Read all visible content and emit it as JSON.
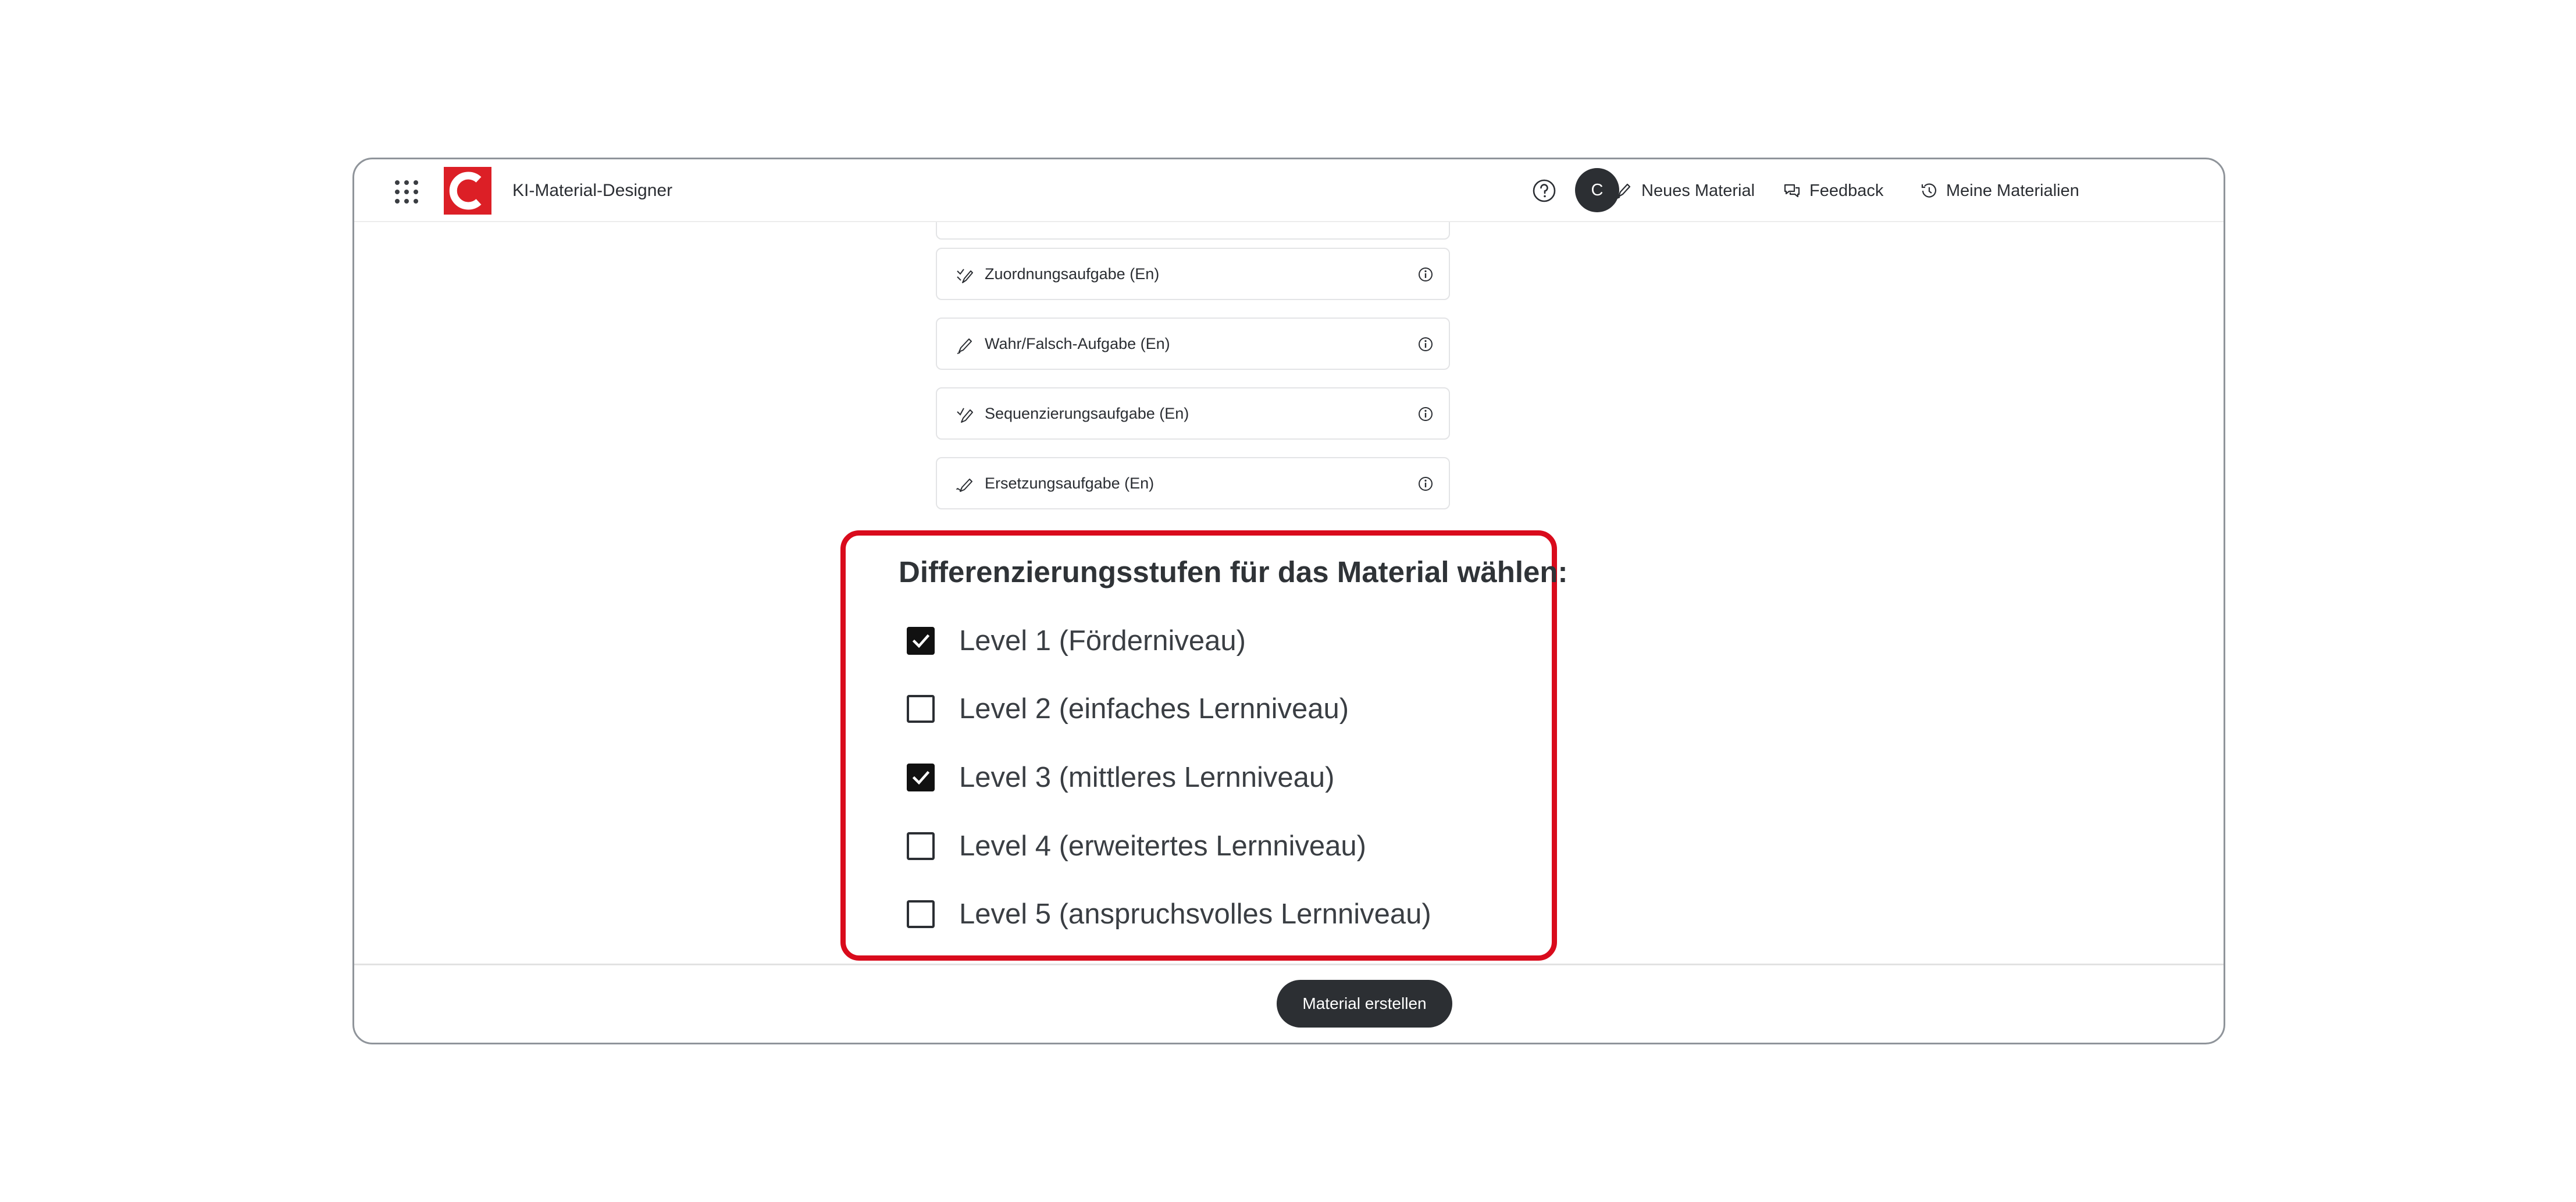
{
  "header": {
    "app_title": "KI-Material-Designer",
    "logo_letter": "C",
    "nav": {
      "new_material": "Neues Material",
      "feedback": "Feedback",
      "my_materials": "Meine Materialien"
    },
    "avatar_initial": "C"
  },
  "task_types": [
    {
      "label": "Zuordnungsaufgabe (En)",
      "icon": "matching-pen-icon"
    },
    {
      "label": "Wahr/Falsch-Aufgabe (En)",
      "icon": "pen-icon"
    },
    {
      "label": "Sequenzierungsaufgabe (En)",
      "icon": "sequence-pen-icon"
    },
    {
      "label": "Ersetzungsaufgabe (En)",
      "icon": "replace-pen-icon"
    }
  ],
  "differentiation": {
    "heading": "Differenzierungsstufen für das Material wählen:",
    "levels": [
      {
        "label": "Level 1 (Förderniveau)",
        "checked": true
      },
      {
        "label": "Level 2 (einfaches Lernniveau)",
        "checked": false
      },
      {
        "label": "Level 3 (mittleres Lernniveau)",
        "checked": true
      },
      {
        "label": "Level 4 (erweitertes Lernniveau)",
        "checked": false
      },
      {
        "label": "Level 5 (anspruchsvolles Lernniveau)",
        "checked": false
      }
    ],
    "highlight_color": "#d90b1c"
  },
  "footer": {
    "create_button": "Material erstellen"
  },
  "colors": {
    "brand": "#dc1f26",
    "dark": "#2c2f33"
  }
}
